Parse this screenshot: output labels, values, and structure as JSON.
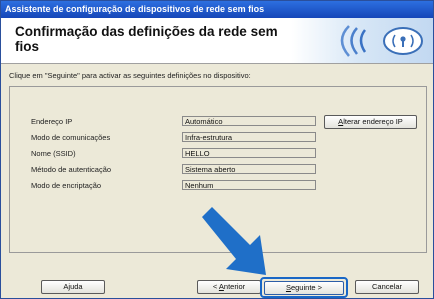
{
  "window": {
    "title": "Assistente de configuração de dispositivos de rede sem fios"
  },
  "header": {
    "title": "Confirmação das definições da rede sem fios"
  },
  "instructions": "Clique em \"Seguinte\" para activar as seguintes definições no dispositivo:",
  "settings": [
    {
      "label": "Endereço IP",
      "value": "Automático"
    },
    {
      "label": "Modo de comunicações",
      "value": "Infra-estrutura"
    },
    {
      "label": "Nome (SSID)",
      "value": "HELLO"
    },
    {
      "label": "Método de autenticação",
      "value": "Sistema aberto"
    },
    {
      "label": "Modo de encriptação",
      "value": "Nenhum"
    }
  ],
  "buttons": {
    "change_ip": {
      "pre": "",
      "mnemonic": "A",
      "post": "lterar endereço IP"
    },
    "help": "Ajuda",
    "back": {
      "pre": "< ",
      "mnemonic": "A",
      "post": "nterior"
    },
    "next": {
      "pre": "",
      "mnemonic": "S",
      "post": "eguinte >"
    },
    "cancel": "Cancelar"
  },
  "colors": {
    "titlebar": "#1f5ad0",
    "focus_ring": "#1967c6",
    "arrow": "#1f6fc8"
  },
  "icons": {
    "banner": "wireless-signal-icon",
    "pointer": "pointing-arrow-icon"
  }
}
